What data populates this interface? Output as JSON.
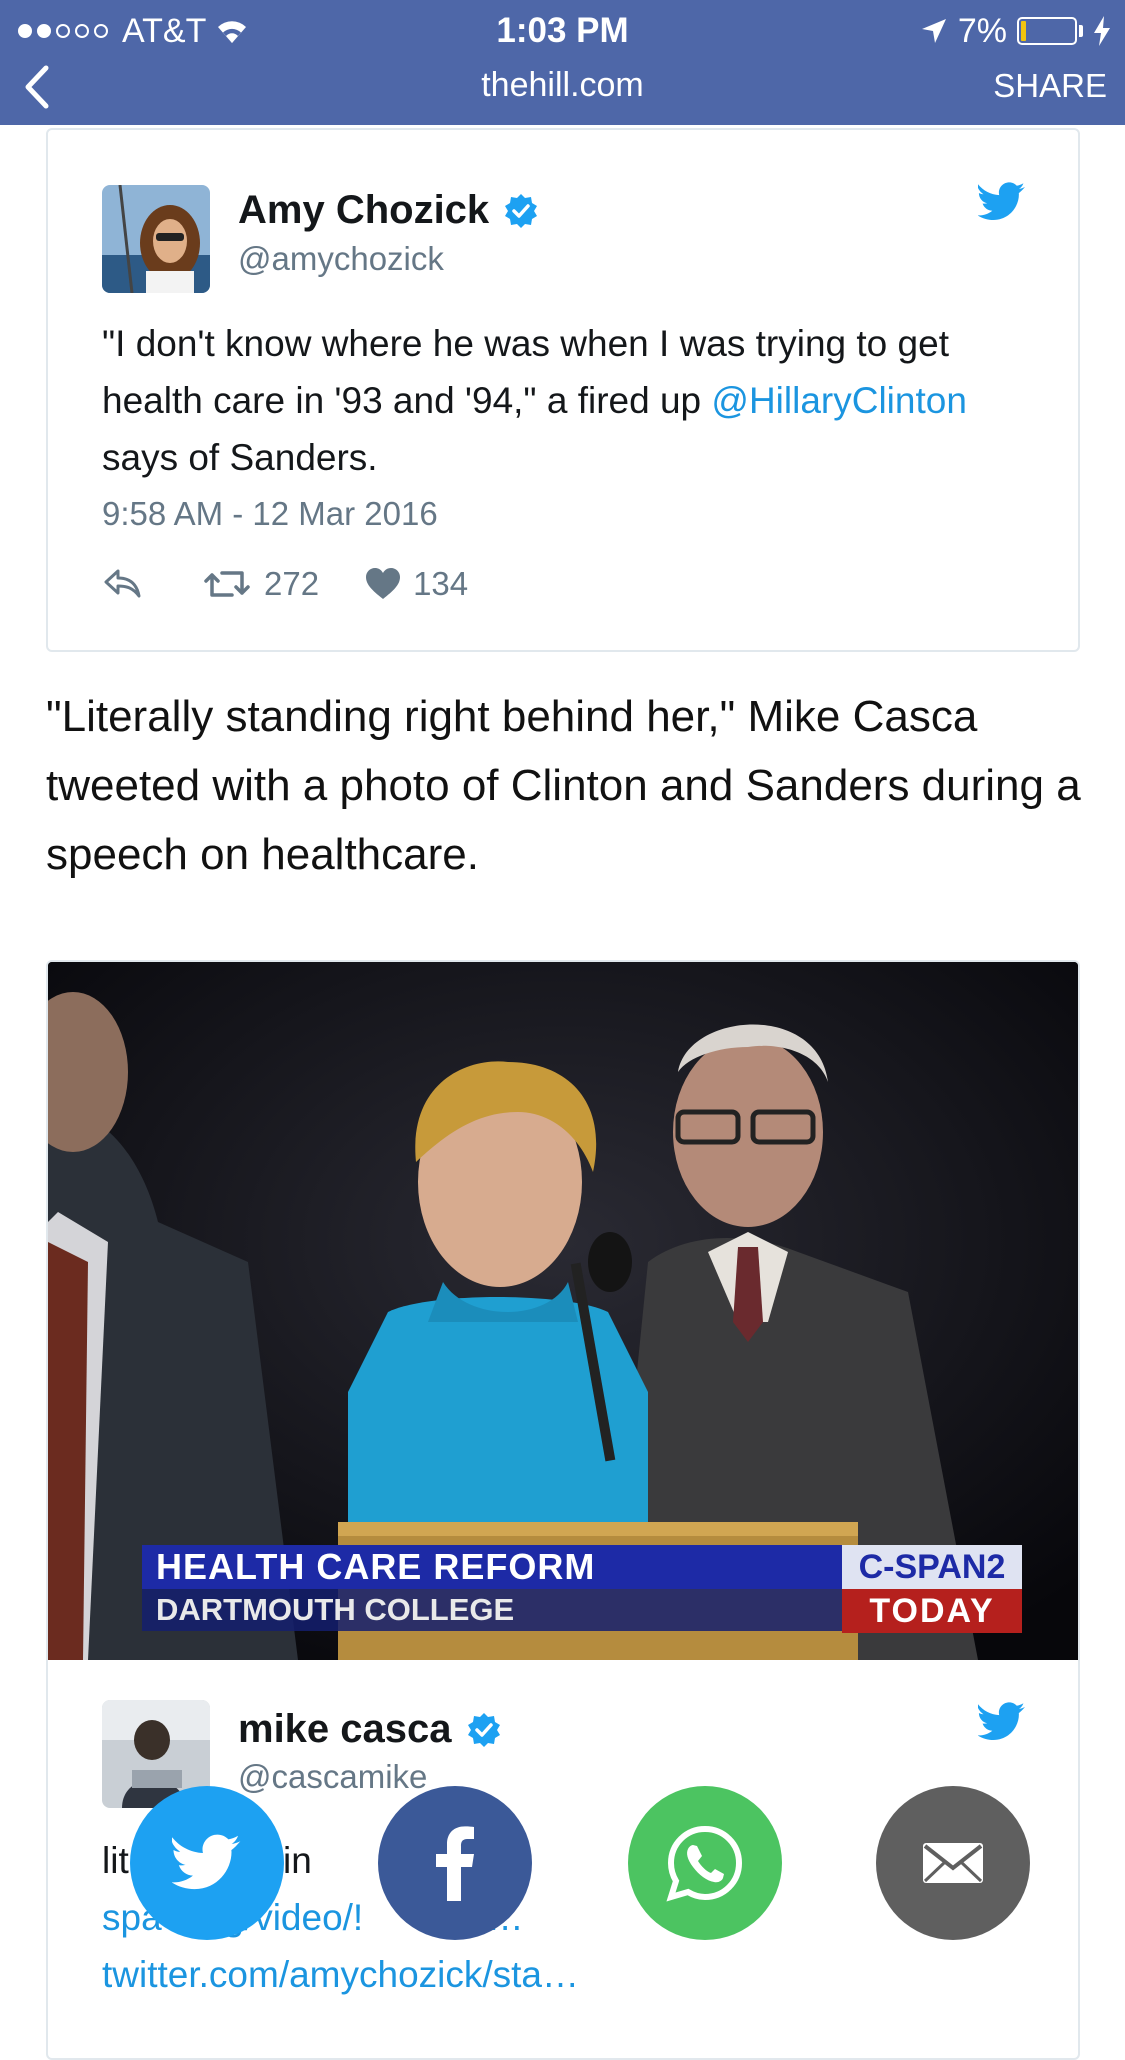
{
  "status_bar": {
    "carrier": "AT&T",
    "time": "1:03 PM",
    "battery": "7%"
  },
  "nav": {
    "domain": "thehill.com",
    "share_label": "SHARE"
  },
  "tweet1": {
    "author": "Amy Chozick",
    "handle": "@amychozick",
    "text_before": "\"I don't know where he was when I was trying to get health care in '93 and '94,\" a fired up ",
    "mention": "@HillaryClinton",
    "text_after": " says of Sanders.",
    "timestamp": "9:58 AM - 12 Mar 2016",
    "retweets": "272",
    "likes": "134"
  },
  "article": {
    "paragraph": "\"Literally standing right behind her,\" Mike Casca tweeted with a photo of Clinton and Sanders during a speech on healthcare."
  },
  "tweet2": {
    "media": {
      "lower_third_title": "HEALTH CARE REFORM",
      "lower_third_subtitle": "DARTMOUTH COLLEGE",
      "network": "C-SPAN2",
      "network_tag": "TODAY"
    },
    "author": "mike casca",
    "handle": "@cascamike",
    "text_visible": "lit         andin            ehind",
    "link1": "spa      g/video/!      622…",
    "link2": "twitter.com/amychozick/sta…"
  },
  "share_buttons": [
    {
      "name": "twitter",
      "icon": "twitter-bird-icon",
      "color": "#1da1f2"
    },
    {
      "name": "facebook",
      "icon": "facebook-f-icon",
      "color": "#3b5998"
    },
    {
      "name": "whatsapp",
      "icon": "whatsapp-phone-icon",
      "color": "#4cc461"
    },
    {
      "name": "email",
      "icon": "envelope-icon",
      "color": "#5f5f5f"
    }
  ],
  "colors": {
    "nav_bar": "#4e67a8",
    "link_blue": "#1b95e0",
    "verified_blue": "#1da1f2",
    "text_gray": "#657786"
  }
}
